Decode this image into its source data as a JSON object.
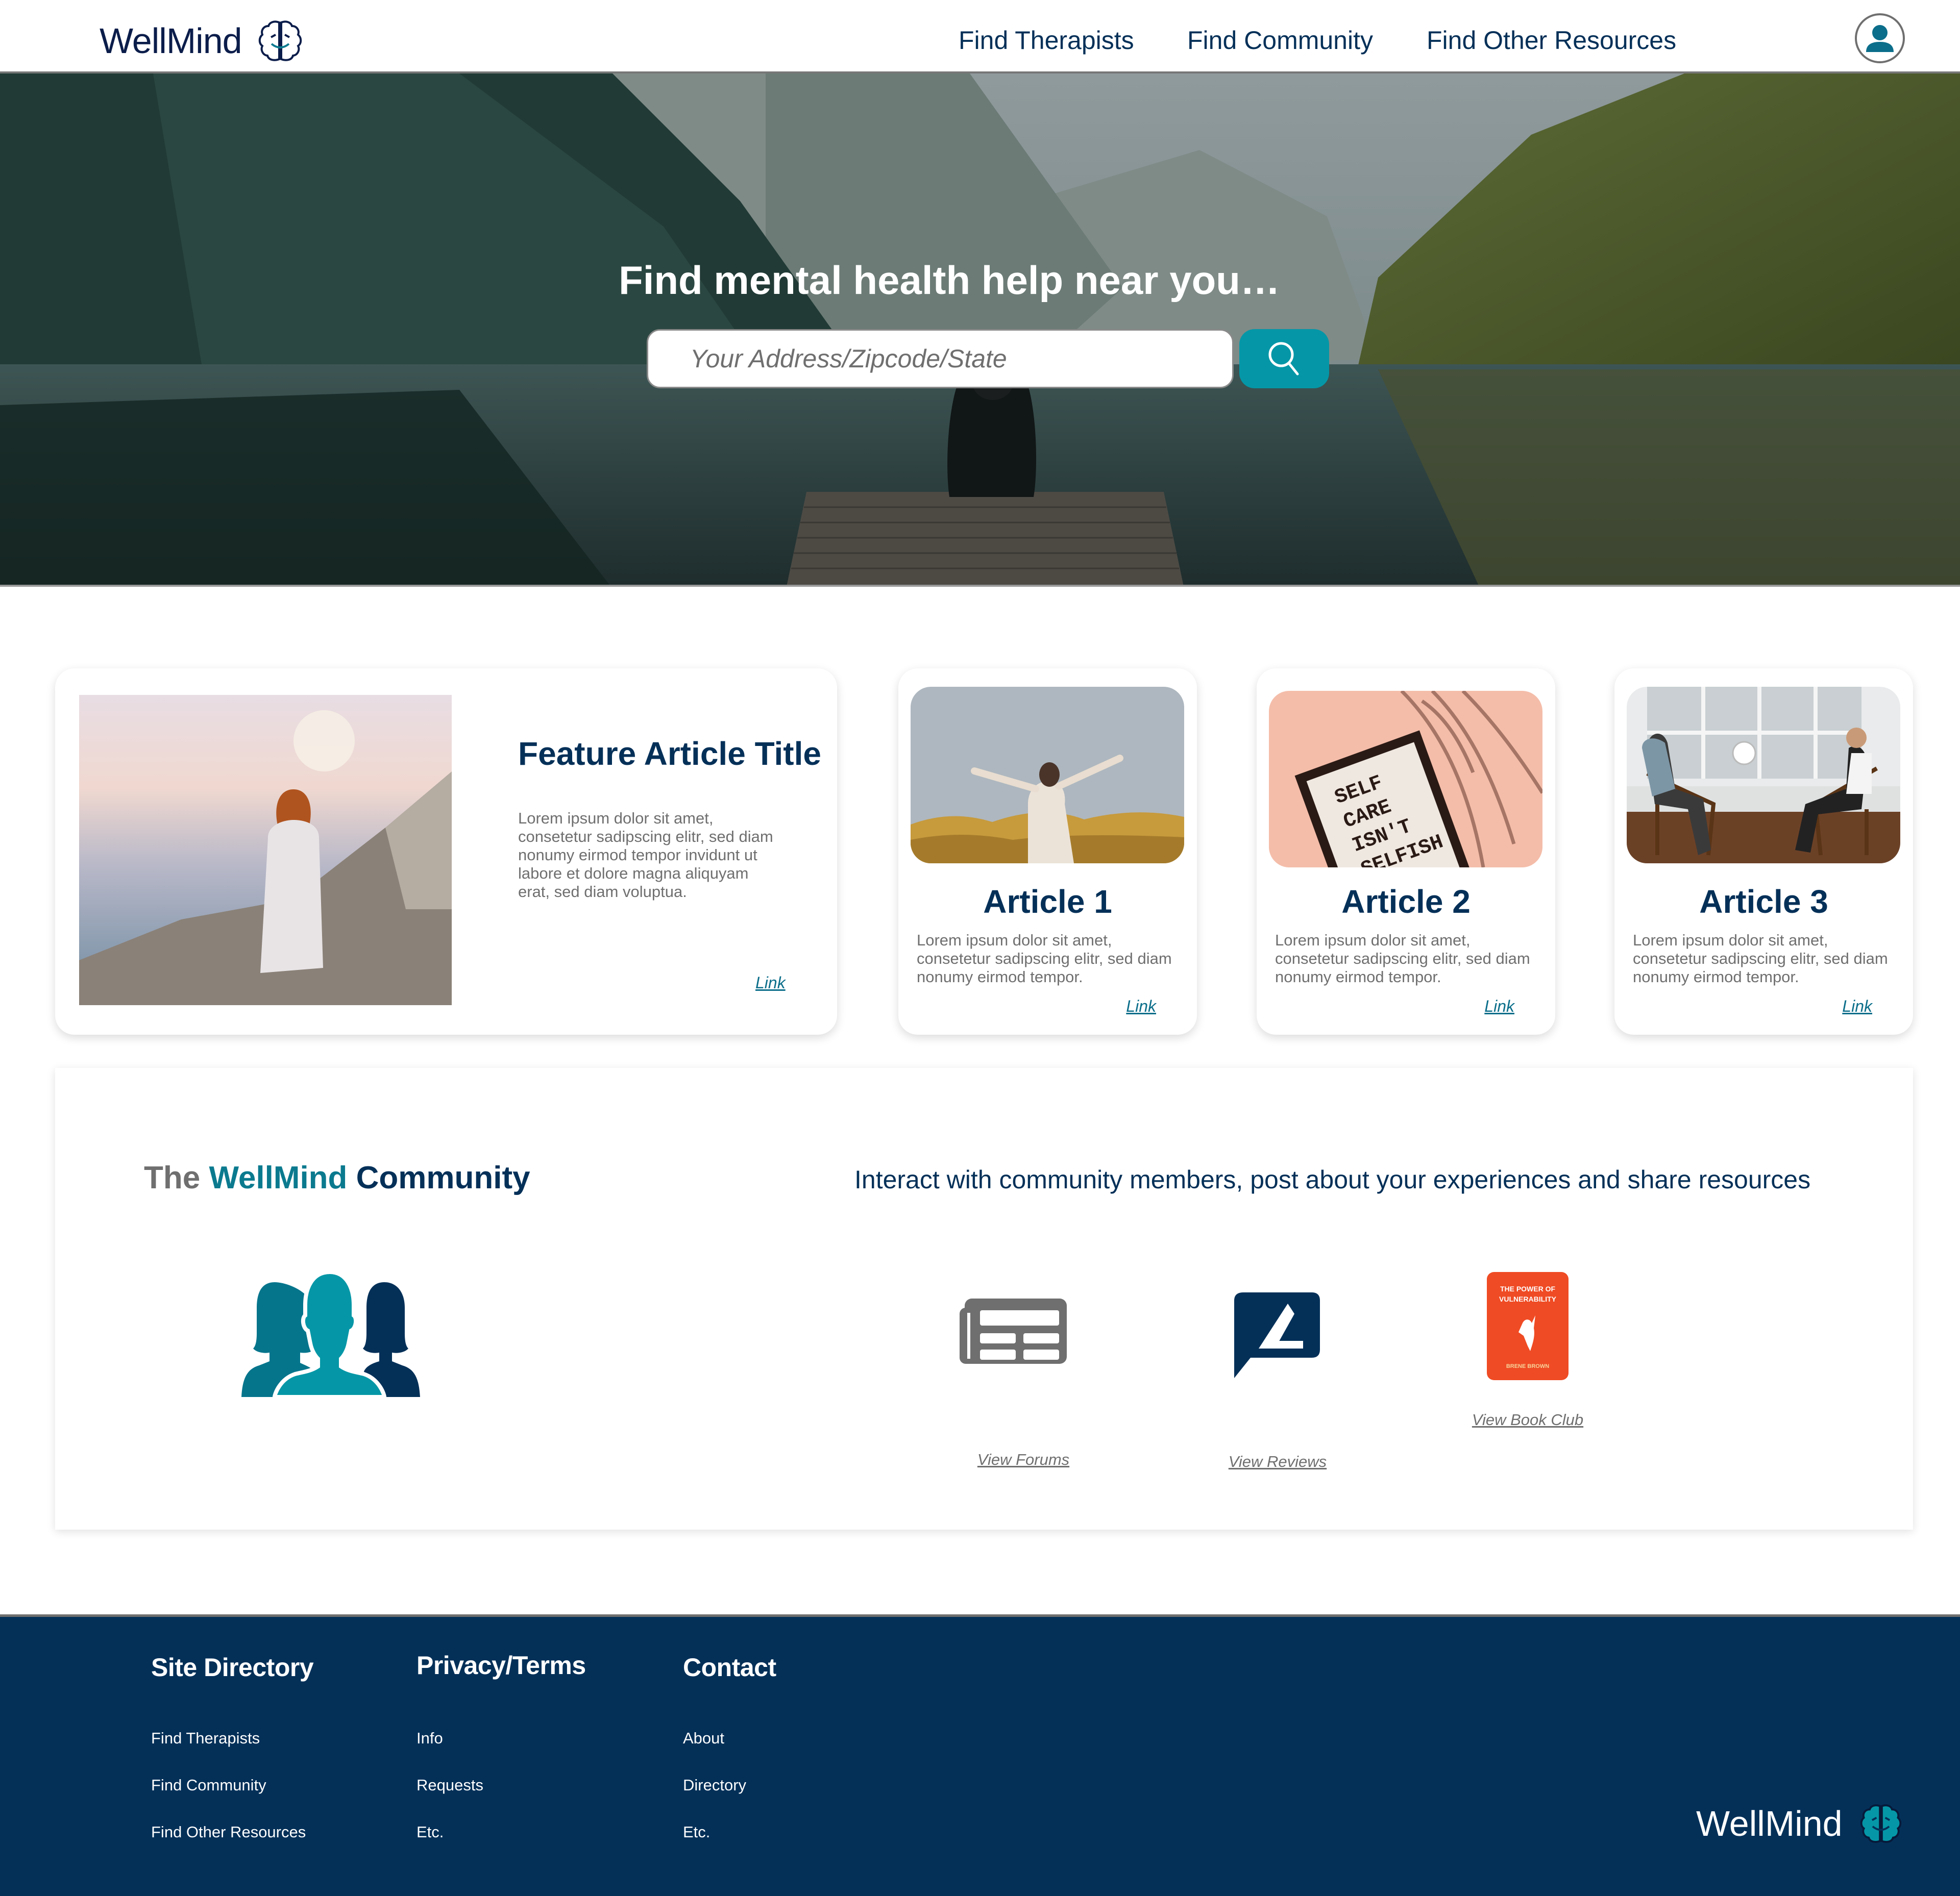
{
  "brand": {
    "name": "WellMind",
    "logo_icon": "brain-smile-icon",
    "colors": {
      "navy": "#043058",
      "teal": "#0597a7",
      "dark_teal": "#0b7a8f",
      "gray_text": "#6f6f6f",
      "book_orange": "#ef4b24"
    }
  },
  "header": {
    "nav": [
      {
        "label": "Find Therapists"
      },
      {
        "label": "Find Community"
      },
      {
        "label": "Find Other Resources"
      }
    ],
    "user_icon": "user-avatar-icon"
  },
  "hero": {
    "title": "Find mental health help near you…",
    "search": {
      "placeholder": "Your Address/Zipcode/State",
      "value": "",
      "button_icon": "search-icon"
    }
  },
  "feature_article": {
    "title": "Feature Article Title",
    "body": "Lorem ipsum dolor sit amet, consetetur sadipscing elitr, sed diam nonumy eirmod tempor invidunt ut labore et dolore magna aliquyam erat, sed diam voluptua.",
    "link": "Link"
  },
  "articles": [
    {
      "title": "Article 1",
      "body": "Lorem ipsum dolor sit amet, consetetur sadipscing elitr, sed diam nonumy eirmod tempor.",
      "link": "Link"
    },
    {
      "title": "Article 2",
      "body": "Lorem ipsum dolor sit amet, consetetur sadipscing elitr, sed diam nonumy eirmod tempor.",
      "link": "Link",
      "image_text": [
        "SELF",
        "CARE",
        "ISN'T",
        "SELFISH"
      ]
    },
    {
      "title": "Article 3",
      "body": "Lorem ipsum dolor sit amet, consetetur sadipscing elitr, sed diam nonumy eirmod tempor.",
      "link": "Link"
    }
  ],
  "community": {
    "title_the": "The",
    "title_brand": "WellMind",
    "title_community": "Community",
    "tagline": "Interact with community members, post about your experiences and share resources",
    "resources": [
      {
        "label": "View Forums",
        "icon": "newspaper-icon"
      },
      {
        "label": "View Reviews",
        "icon": "review-edit-icon"
      },
      {
        "label": "View Book Club",
        "icon": "book-cover-icon",
        "book_title": [
          "THE POWER OF",
          "VULNERABILITY"
        ],
        "book_author": "BRENE BROWN"
      }
    ]
  },
  "footer": {
    "columns": [
      {
        "heading": "Site Directory",
        "links": [
          "Find Therapists",
          "Find Community",
          "Find Other Resources"
        ]
      },
      {
        "heading": "Privacy/Terms",
        "links": [
          "Info",
          "Requests",
          "Etc."
        ]
      },
      {
        "heading": "Contact",
        "links": [
          "About",
          "Directory",
          "Etc."
        ]
      }
    ],
    "logo_text": "WellMind"
  }
}
